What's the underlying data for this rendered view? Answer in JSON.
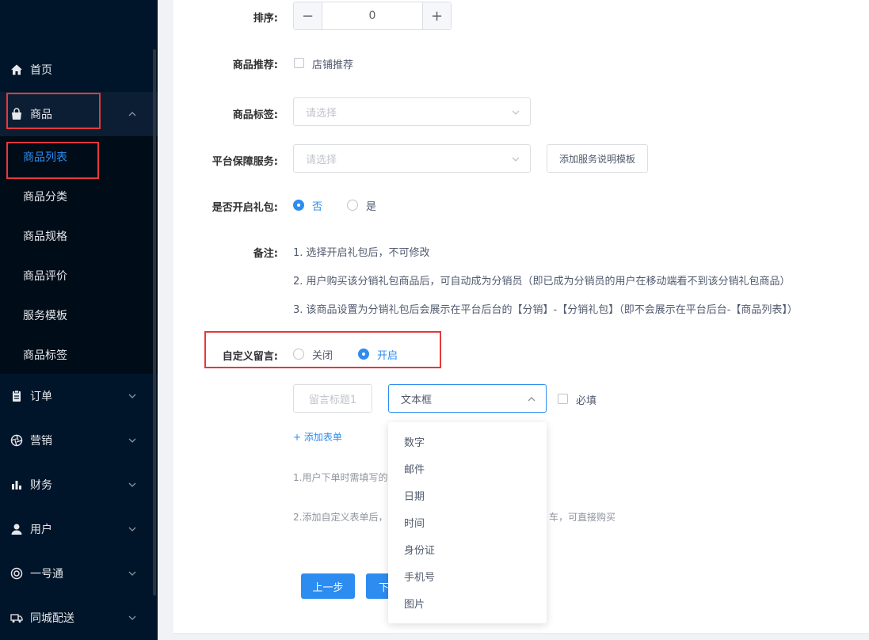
{
  "sidebar": {
    "menu": [
      {
        "label": "首页",
        "icon": "home-icon"
      },
      {
        "label": "商品",
        "icon": "bag-icon"
      },
      {
        "label": "订单",
        "icon": "clipboard-icon"
      },
      {
        "label": "营销",
        "icon": "aperture-icon"
      },
      {
        "label": "财务",
        "icon": "bar-chart-icon"
      },
      {
        "label": "用户",
        "icon": "user-icon"
      },
      {
        "label": "一号通",
        "icon": "lifebuoy-icon"
      },
      {
        "label": "同城配送",
        "icon": "truck-icon"
      }
    ],
    "submenu": [
      {
        "label": "商品列表"
      },
      {
        "label": "商品分类"
      },
      {
        "label": "商品规格"
      },
      {
        "label": "商品评价"
      },
      {
        "label": "服务模板"
      },
      {
        "label": "商品标签"
      }
    ]
  },
  "form": {
    "sort_label": "排序:",
    "sort_value": "0",
    "recommend_label": "商品推荐:",
    "recommend_option": "店铺推荐",
    "tags_label": "商品标签:",
    "tags_placeholder": "请选择",
    "service_label": "平台保障服务:",
    "service_placeholder": "请选择",
    "service_button": "添加服务说明模板",
    "gift_label": "是否开启礼包:",
    "gift_no": "否",
    "gift_yes": "是",
    "note_label": "备注:",
    "notes": [
      "1. 选择开启礼包后，不可修改",
      "2. 用户购买该分销礼包商品后，可自动成为分销员（即已成为分销员的用户在移动端看不到该分销礼包商品）",
      "3. 该商品设置为分销礼包后会展示在平台后台的【分销】-【分销礼包】（即不会展示在平台后台-【商品列表】）"
    ],
    "custom_msg_label": "自定义留言:",
    "custom_off": "关闭",
    "custom_on": "开启",
    "msg_title_placeholder": "留言标题1",
    "msg_type_value": "文本框",
    "required_label": "必填",
    "add_form_link": "+ 添加表单",
    "tip1": "1.用户下单时需填写的",
    "tip2_a": "2.添加自定义表单后，",
    "tip2_b": "车，可直接购买",
    "prev_button": "上一步",
    "next_button": "下"
  },
  "dropdown_options": [
    "数字",
    "邮件",
    "日期",
    "时间",
    "身份证",
    "手机号",
    "图片"
  ],
  "colors": {
    "sidebar_bg": "#001529",
    "accent": "#2d8cf0",
    "highlight_box": "#e5393b"
  }
}
